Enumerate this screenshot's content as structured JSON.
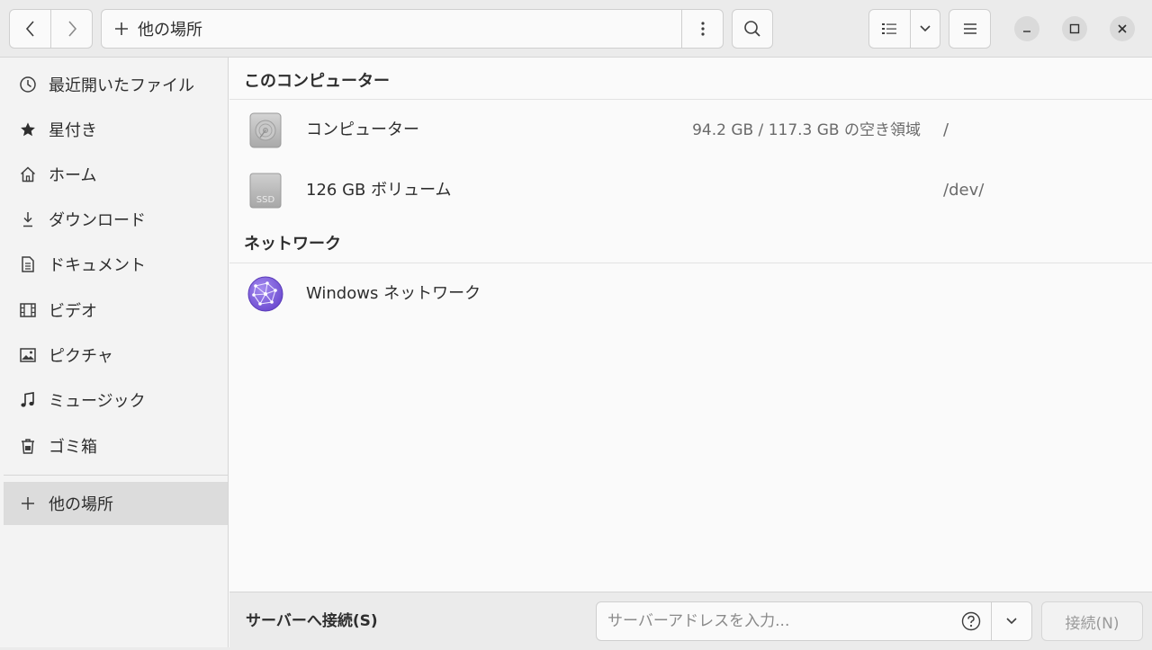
{
  "header": {
    "back_icon": "chevron-left-icon",
    "forward_icon": "chevron-right-icon",
    "path_icon": "plus-icon",
    "path_label": "他の場所",
    "path_menu_icon": "vertical-dots-icon",
    "search_icon": "search-icon",
    "view_list_icon": "list-view-icon",
    "view_dropdown_icon": "chevron-down-icon",
    "main_menu_icon": "hamburger-icon",
    "minimize_icon": "minimize-icon",
    "maximize_icon": "maximize-icon",
    "close_icon": "close-icon"
  },
  "sidebar": {
    "items": [
      {
        "label": "最近開いたファイル",
        "icon": "clock-icon"
      },
      {
        "label": "星付き",
        "icon": "star-icon"
      },
      {
        "label": "ホーム",
        "icon": "home-icon"
      },
      {
        "label": "ダウンロード",
        "icon": "download-icon"
      },
      {
        "label": "ドキュメント",
        "icon": "document-icon"
      },
      {
        "label": "ビデオ",
        "icon": "film-icon"
      },
      {
        "label": "ピクチャ",
        "icon": "picture-icon"
      },
      {
        "label": "ミュージック",
        "icon": "music-icon"
      },
      {
        "label": "ゴミ箱",
        "icon": "trash-icon"
      }
    ],
    "other_locations": {
      "label": "他の場所",
      "icon": "plus-icon",
      "active": true
    }
  },
  "main": {
    "computer_section": {
      "title": "このコンピューター",
      "items": [
        {
          "name": "コンピューター",
          "space": "94.2 GB / 117.3 GB の空き領域",
          "mount": "/",
          "icon": "hard-disk-icon"
        },
        {
          "name": "126 GB ボリューム",
          "space": "",
          "mount": "/dev/",
          "icon": "ssd-drive-icon",
          "icon_text": "SSD"
        }
      ]
    },
    "network_section": {
      "title": "ネットワーク",
      "items": [
        {
          "name": "Windows ネットワーク",
          "icon": "network-globe-icon"
        }
      ]
    }
  },
  "bottom": {
    "connect_label": "サーバーへ接続(S)",
    "server_placeholder": "サーバーアドレスを入力...",
    "server_value": "",
    "help_icon": "help-circle-icon",
    "dropdown_icon": "chevron-down-icon",
    "connect_button": "接続(N)"
  },
  "colors": {
    "header_bg": "#ebebeb",
    "sidebar_bg": "#f3f3f3",
    "selected_bg": "#dcdcdc",
    "globe": "#7e5bd9"
  }
}
